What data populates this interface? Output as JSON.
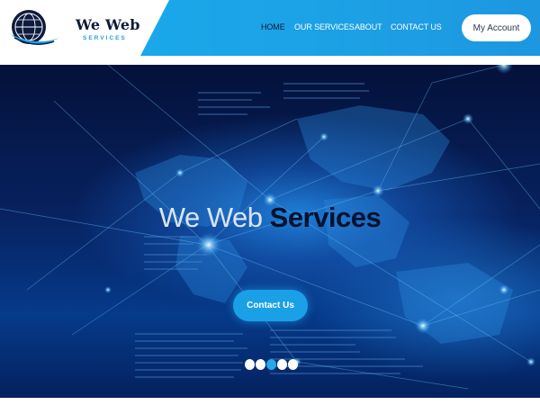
{
  "brand": {
    "name": "We Web",
    "tagline": "SERVICES",
    "colors": {
      "primary": "#1d9fe4",
      "dark": "#101a3a"
    }
  },
  "nav": {
    "items": [
      {
        "label": "HOME",
        "active": true
      },
      {
        "label": "OUR SERVICES",
        "active": false
      },
      {
        "label": "ABOUT",
        "active": false
      },
      {
        "label": "CONTACT US",
        "active": false
      }
    ]
  },
  "account": {
    "label": "My Account"
  },
  "hero": {
    "title_light": "We Web",
    "title_bold": "Services",
    "cta_label": "Contact Us",
    "slides": {
      "count": 5,
      "active_index": 2
    }
  }
}
